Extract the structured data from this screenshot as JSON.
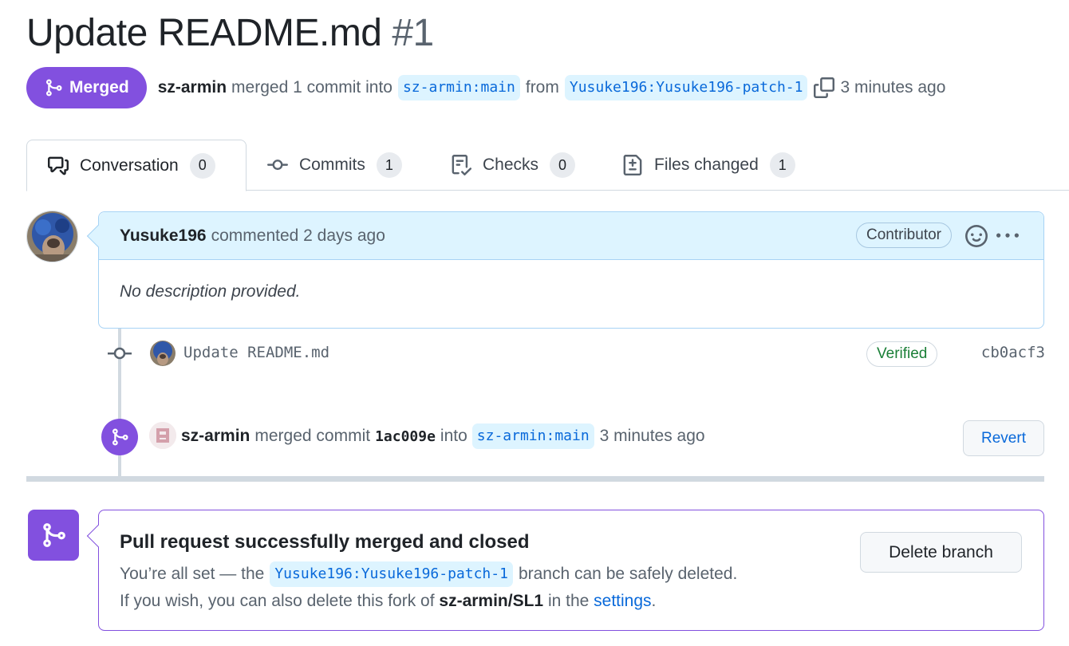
{
  "pr": {
    "title": "Update README.md",
    "number": "#1",
    "state_label": "Merged",
    "state_icon": "git-merge-icon",
    "merger": "sz-armin",
    "merged_text": "merged 1 commit into",
    "base_ref": "sz-armin:main",
    "from_text": "from",
    "head_ref": "Yusuke196:Yusuke196-patch-1",
    "time": "3 minutes ago"
  },
  "tabs": [
    {
      "label": "Conversation",
      "count": "0",
      "icon": "comment-discussion-icon",
      "active": true
    },
    {
      "label": "Commits",
      "count": "1",
      "icon": "git-commit-icon"
    },
    {
      "label": "Checks",
      "count": "0",
      "icon": "checklist-icon"
    },
    {
      "label": "Files changed",
      "count": "1",
      "icon": "file-diff-icon"
    }
  ],
  "comment": {
    "author": "Yusuke196",
    "meta": "commented 2 days ago",
    "role_badge": "Contributor",
    "body": "No description provided."
  },
  "commit": {
    "message": "Update README.md",
    "verified": "Verified",
    "sha": "cb0acf3"
  },
  "merge_event": {
    "actor": "sz-armin",
    "text": "merged commit",
    "sha": "1ac009e",
    "into": "into",
    "ref": "sz-armin:main",
    "time": "3 minutes ago",
    "revert_label": "Revert"
  },
  "merged_box": {
    "title": "Pull request successfully merged and closed",
    "line1_prefix": "You’re all set — the",
    "branch": "Yusuke196:Yusuke196-patch-1",
    "line1_suffix": "branch can be safely deleted.",
    "line2_prefix": "If you wish, you can also delete this fork of",
    "repo": "sz-armin/SL1",
    "line2_mid": "in the",
    "settings_link": "settings",
    "line2_suffix": ".",
    "delete_label": "Delete branch"
  },
  "colors": {
    "merged_purple": "#8250df",
    "link_blue": "#0969da",
    "ref_bg": "#ddf4ff",
    "verified_green": "#1a7f37"
  }
}
